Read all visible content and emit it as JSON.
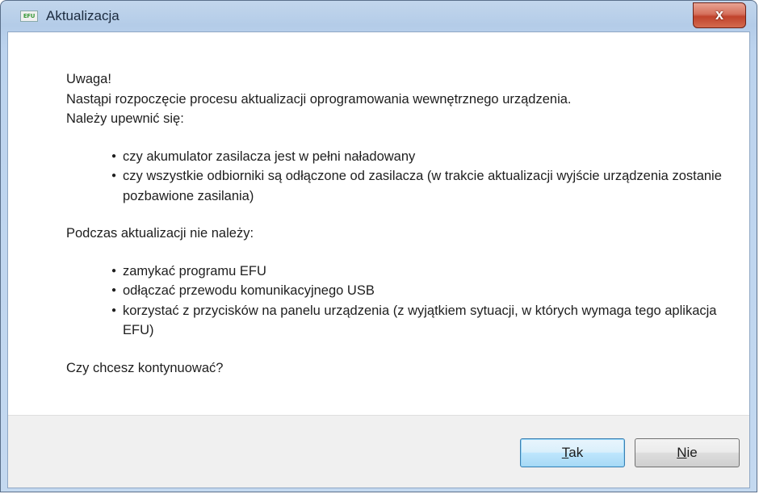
{
  "window": {
    "title": "Aktualizacja",
    "app_icon_text": "EFU",
    "close_glyph": "x"
  },
  "message": {
    "heading": "Uwaga!",
    "line1": "Nastąpi rozpoczęcie procesu aktualizacji oprogramowania wewnętrznego urządzenia.",
    "line2": "Należy upewnić się:",
    "checklist": [
      "czy akumulator zasilacza jest w pełni naładowany",
      "czy wszystkie odbiorniki są odłączone od zasilacza (w trakcie aktualizacji wyjście urządzenia zostanie pozbawione zasilania)"
    ],
    "during_heading": "Podczas aktualizacji nie należy:",
    "prohibited": [
      "zamykać programu EFU",
      "odłączać przewodu komunikacyjnego USB",
      "korzystać z przycisków na panelu urządzenia (z wyjątkiem sytuacji, w których wymaga tego aplikacja EFU)"
    ],
    "question": "Czy chcesz kontynuować?"
  },
  "buttons": {
    "yes": {
      "accel": "T",
      "rest": "ak"
    },
    "no": {
      "accel": "N",
      "rest": "ie"
    }
  }
}
